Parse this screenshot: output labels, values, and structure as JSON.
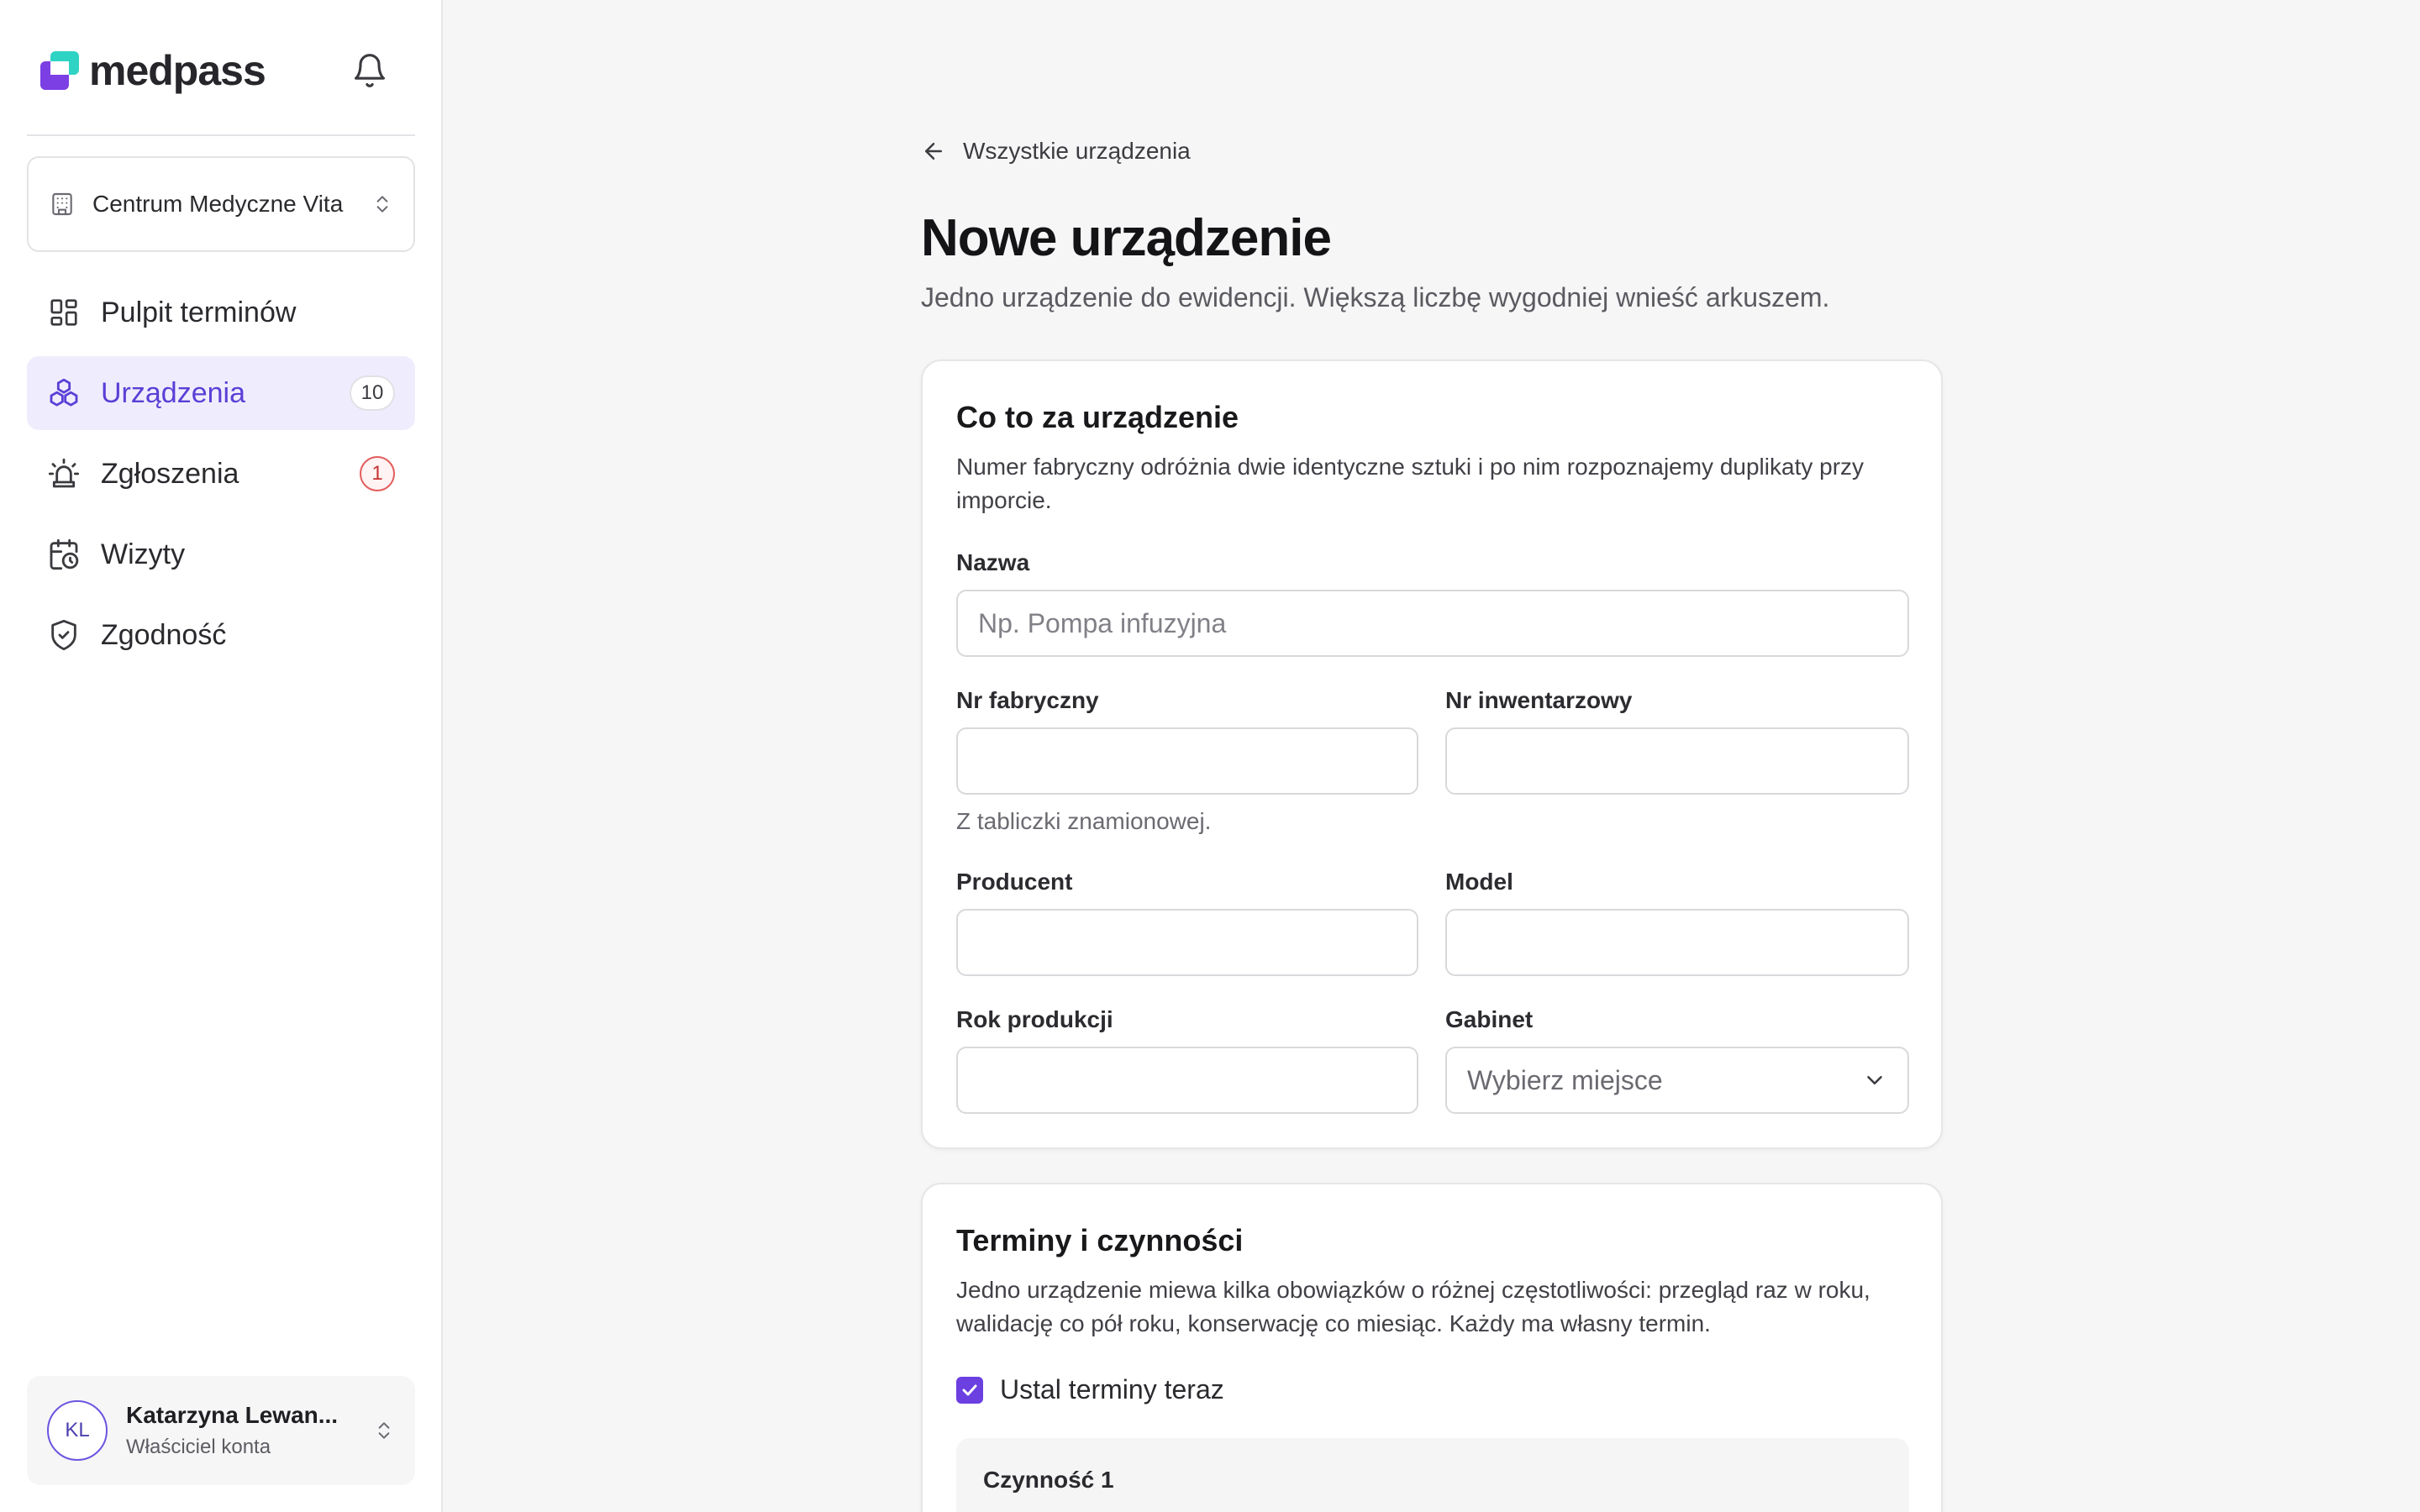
{
  "brand": {
    "name": "medpass"
  },
  "org": {
    "name": "Centrum Medyczne Vita"
  },
  "nav": {
    "items": [
      {
        "label": "Pulpit terminów",
        "icon": "dashboard-icon",
        "badge": ""
      },
      {
        "label": "Urządzenia",
        "icon": "devices-icon",
        "badge": "10",
        "active": true
      },
      {
        "label": "Zgłoszenia",
        "icon": "alarm-icon",
        "badge": "1"
      },
      {
        "label": "Wizyty",
        "icon": "calendar-clock-icon",
        "badge": ""
      },
      {
        "label": "Zgodność",
        "icon": "shield-check-icon",
        "badge": ""
      }
    ]
  },
  "user": {
    "initials": "KL",
    "name": "Katarzyna Lewan...",
    "role": "Właściciel konta"
  },
  "page": {
    "back_label": "Wszystkie urządzenia",
    "title": "Nowe urządzenie",
    "subtitle": "Jedno urządzenie do ewidencji. Większą liczbę wygodniej wnieść arkuszem."
  },
  "device_section": {
    "title": "Co to za urządzenie",
    "description": "Numer fabryczny odróżnia dwie identyczne sztuki i po nim rozpoznajemy duplikaty przy imporcie.",
    "name_label": "Nazwa",
    "name_placeholder": "Np. Pompa infuzyjna",
    "serial_label": "Nr fabryczny",
    "serial_hint": "Z tabliczki znamionowej.",
    "inventory_label": "Nr inwentarzowy",
    "manufacturer_label": "Producent",
    "model_label": "Model",
    "year_label": "Rok produkcji",
    "room_label": "Gabinet",
    "room_placeholder": "Wybierz miejsce"
  },
  "schedule_section": {
    "title": "Terminy i czynności",
    "description": "Jedno urządzenie miewa kilka obowiązków o różnej częstotliwości: przegląd raz w roku, walidację co pół roku, konserwację co miesiąc. Każdy ma własny termin.",
    "checkbox_label": "Ustal terminy teraz",
    "checkbox_checked": true,
    "step_label": "Czynność 1"
  },
  "colors": {
    "accent": "#6b3fe0",
    "active_bg": "#efedfd",
    "alert": "#e25c5c"
  }
}
